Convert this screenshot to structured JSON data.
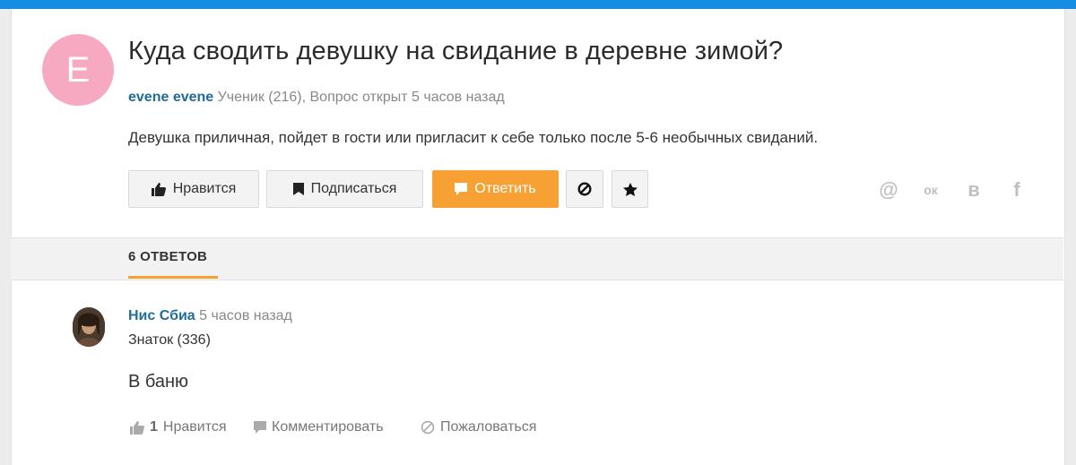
{
  "question": {
    "avatar_letter": "E",
    "title": "Куда сводить девушку на свидание в деревне зимой?",
    "author": "evene evene",
    "author_meta": "Ученик (216), Вопрос открыт 5 часов назад",
    "description": "Девушка приличная, пойдет в гости или пригласит к себе только после 5-6 необычных свиданий."
  },
  "actions": {
    "like_label": "Нравится",
    "subscribe_label": "Подписаться",
    "answer_label": "Ответить"
  },
  "share": {
    "at": "@",
    "ok": "ок",
    "vk": "в",
    "fb": "f"
  },
  "answers_tab": "6 ОТВЕТОВ",
  "answer": {
    "author": "Нис Сбиа",
    "time": "5 часов назад",
    "rank": "Знаток (336)",
    "text": "В баню",
    "like_count": "1",
    "like_label": "Нравится",
    "comment_label": "Комментировать",
    "report_label": "Пожаловаться"
  },
  "colors": {
    "top_bar": "#168de2",
    "accent": "#f7a135",
    "author_link": "#1f6c99",
    "avatar_bg": "#f7a9c1"
  }
}
